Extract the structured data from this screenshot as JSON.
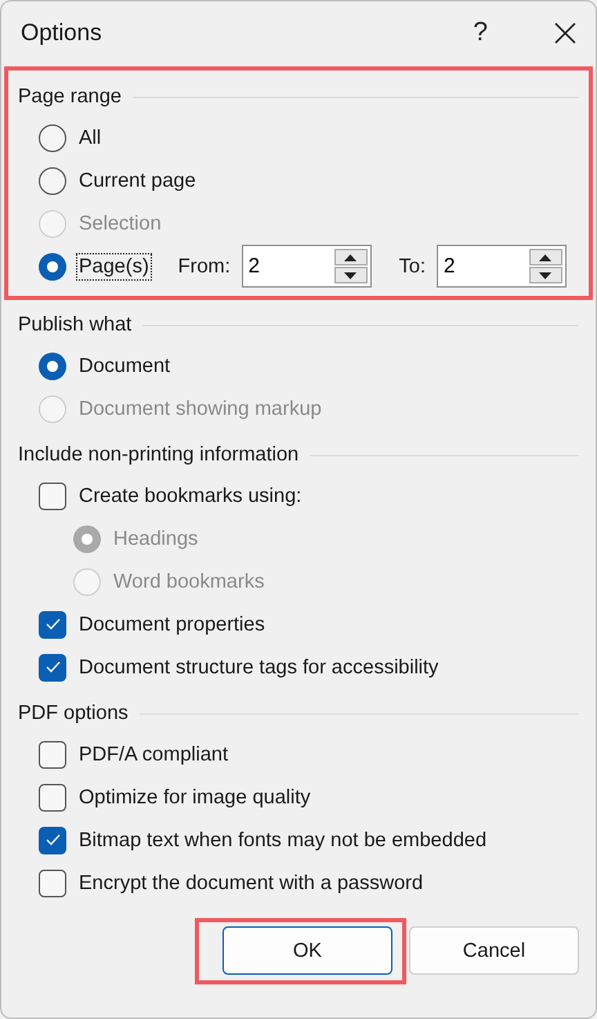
{
  "window": {
    "title": "Options",
    "help": "?"
  },
  "sections": [
    {
      "title": "Page range",
      "highlighted": true,
      "items": [
        {
          "kind": "radio",
          "label": "All",
          "selected": false,
          "disabled": false
        },
        {
          "kind": "radio",
          "label": "Current page",
          "selected": false,
          "disabled": false
        },
        {
          "kind": "radio",
          "label": "Selection",
          "selected": false,
          "disabled": true
        },
        {
          "kind": "range",
          "label": "Page(s)",
          "selected": true,
          "disabled": false,
          "focused": true,
          "from": {
            "label": "From:",
            "value": "2"
          },
          "to": {
            "label": "To:",
            "value": "2"
          }
        }
      ]
    },
    {
      "title": "Publish what",
      "items": [
        {
          "kind": "radio",
          "label": "Document",
          "selected": true,
          "disabled": false
        },
        {
          "kind": "radio",
          "label": "Document showing markup",
          "selected": false,
          "disabled": true
        }
      ]
    },
    {
      "title": "Include non-printing information",
      "items": [
        {
          "kind": "checkbox",
          "label": "Create bookmarks using:",
          "checked": false,
          "disabled": false,
          "children": [
            {
              "kind": "radio",
              "label": "Headings",
              "selected": true,
              "disabled": true
            },
            {
              "kind": "radio",
              "label": "Word bookmarks",
              "selected": false,
              "disabled": true
            }
          ]
        },
        {
          "kind": "checkbox",
          "label": "Document properties",
          "checked": true,
          "disabled": false
        },
        {
          "kind": "checkbox",
          "label": "Document structure tags for accessibility",
          "checked": true,
          "disabled": false
        }
      ]
    },
    {
      "title": "PDF options",
      "items": [
        {
          "kind": "checkbox",
          "label": "PDF/A compliant",
          "checked": false,
          "disabled": false
        },
        {
          "kind": "checkbox",
          "label": "Optimize for image quality",
          "checked": false,
          "disabled": false
        },
        {
          "kind": "checkbox",
          "label": "Bitmap text when fonts may not be embedded",
          "checked": true,
          "disabled": false
        },
        {
          "kind": "checkbox",
          "label": "Encrypt the document with a password",
          "checked": false,
          "disabled": false
        }
      ]
    }
  ],
  "buttons": [
    {
      "label": "OK",
      "default": true,
      "highlighted": true
    },
    {
      "label": "Cancel",
      "default": false
    }
  ]
}
